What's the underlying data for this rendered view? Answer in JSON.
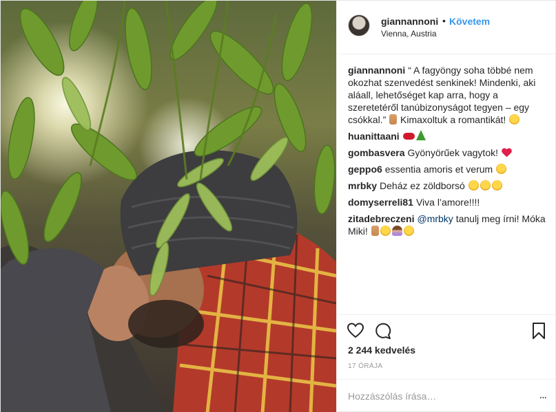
{
  "post": {
    "author": "giannannoni",
    "follow_label": "Követem",
    "dot": "•",
    "location": "Vienna, Austria"
  },
  "comments": [
    {
      "user": "giannannoni",
      "text": "“ A fagyöngy soha többé nem okozhat szenvedést senkinek! Mindenki, aki aláall, lehetőséget kap arra, hogy a szeretetéről tanúbizonyságot tegyen – egy csókkal.”",
      "text2": "Kimaxoltuk a romantikát!",
      "emojis": [
        "hand-emoji",
        "laughing-face-emoji"
      ]
    },
    {
      "user": "huanittaani",
      "text": "",
      "emojis": [
        "lips-emoji",
        "christmas-tree-emoji"
      ]
    },
    {
      "user": "gombasvera",
      "text": "Gyönyörűek vagytok!",
      "emojis": [
        "heart-emoji"
      ]
    },
    {
      "user": "geppo6",
      "text": "essentia amoris et verum",
      "emojis": [
        "smiling-face-emoji"
      ]
    },
    {
      "user": "mrbky",
      "text": "Deház ez zöldborsó",
      "emojis": [
        "laughing-face-emoji",
        "laughing-face-emoji",
        "laughing-face-emoji"
      ]
    },
    {
      "user": "domyserreli81",
      "text": "Viva l’amore!!!!",
      "emojis": []
    },
    {
      "user": "zitadebreczeni",
      "mention": "@mrbky",
      "text": "tanulj meg írni! Móka Miki!",
      "emojis": [
        "hand-emoji",
        "laughing-face-emoji",
        "woman-shrugging-emoji",
        "yum-face-emoji"
      ]
    }
  ],
  "stats": {
    "likes": "2 244 kedvelés",
    "time": "17 ÓRÁJA"
  },
  "add_comment": {
    "placeholder": "Hozzászólás írása…",
    "more": "..."
  },
  "icons": {
    "like": "heart-outline-icon",
    "comment": "speech-bubble-icon",
    "save": "bookmark-icon"
  }
}
